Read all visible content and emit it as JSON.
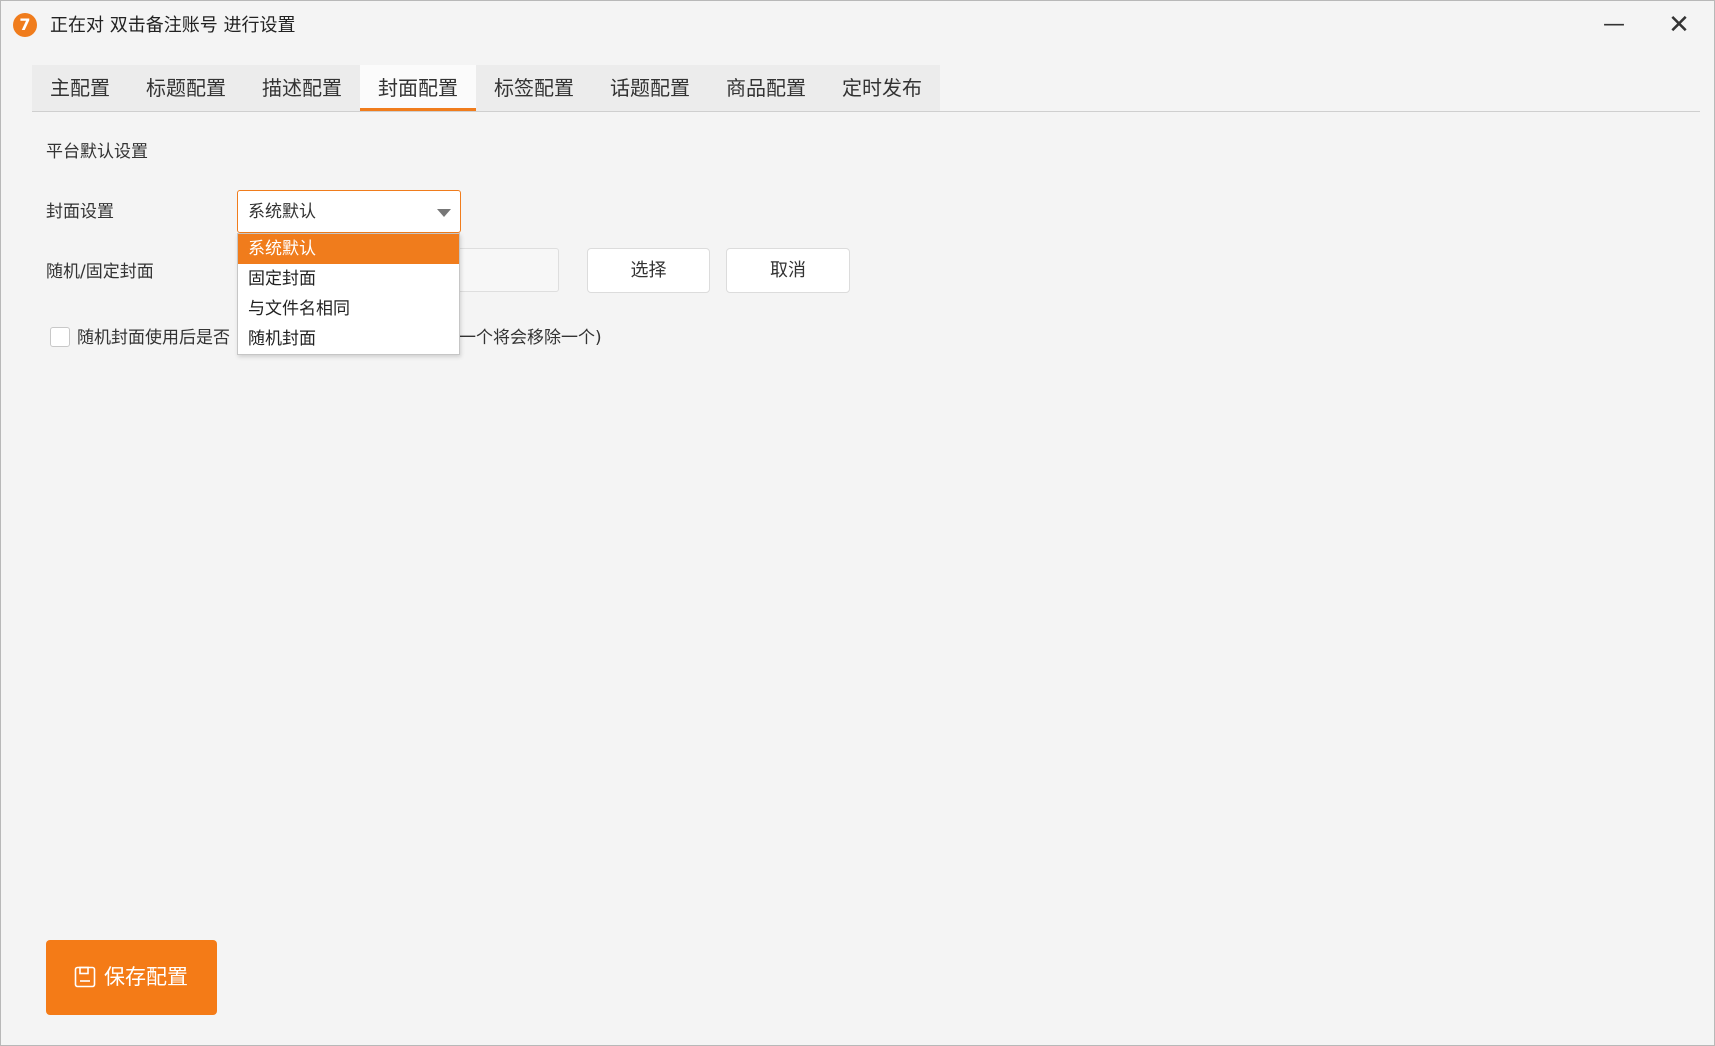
{
  "window": {
    "app_icon_text": "7",
    "title": "正在对 双击备注账号 进行设置",
    "minimize_glyph": "—",
    "close_glyph": "✕"
  },
  "tabs": [
    {
      "label": "主配置",
      "active": false
    },
    {
      "label": "标题配置",
      "active": false
    },
    {
      "label": "描述配置",
      "active": false
    },
    {
      "label": "封面配置",
      "active": true
    },
    {
      "label": "标签配置",
      "active": false
    },
    {
      "label": "话题配置",
      "active": false
    },
    {
      "label": "商品配置",
      "active": false
    },
    {
      "label": "定时发布",
      "active": false
    }
  ],
  "section": {
    "title": "平台默认设置"
  },
  "cover_setting": {
    "label": "封面设置",
    "selected": "系统默认",
    "options": [
      "系统默认",
      "固定封面",
      "与文件名相同",
      "随机封面"
    ],
    "highlighted_index": 0
  },
  "random_fixed_cover": {
    "label": "随机/固定封面",
    "path_value": "",
    "select_button": "选择",
    "cancel_button": "取消"
  },
  "remove_after_use": {
    "checked": false,
    "label_visible_left": "随机封面使用后是否",
    "label_visible_right": "一个将会移除一个)"
  },
  "footer": {
    "save_button": "保存配置"
  },
  "colors": {
    "accent": "#f07c1c",
    "save_button": "#f47b17",
    "background": "#f4f4f4"
  }
}
